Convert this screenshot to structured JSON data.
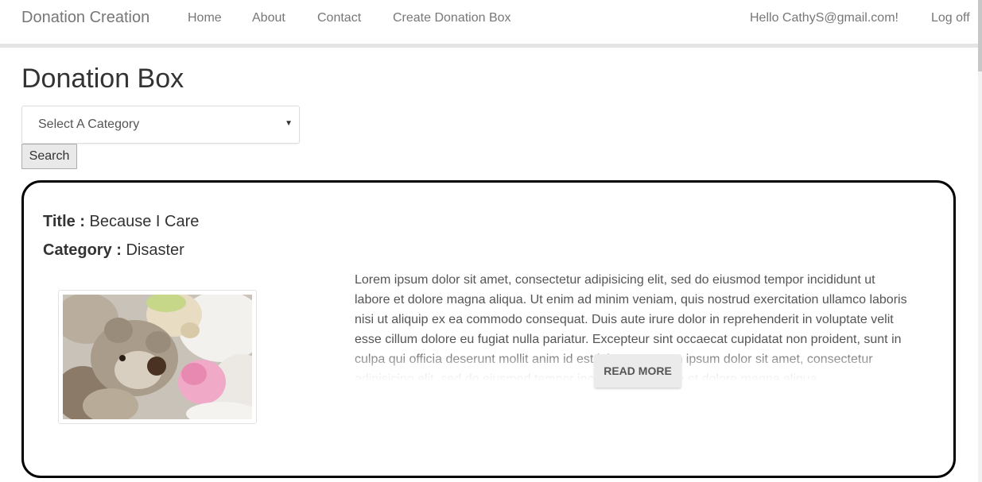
{
  "navbar": {
    "brand": "Donation Creation",
    "links": [
      "Home",
      "About",
      "Contact",
      "Create Donation Box"
    ],
    "greeting": "Hello CathyS@gmail.com!",
    "logoff": "Log off"
  },
  "page": {
    "title": "Donation Box"
  },
  "filter": {
    "category_selected": "Select A Category",
    "search_label": "Search"
  },
  "donation": {
    "title_label": "Title :",
    "title_value": "Because I Care",
    "category_label": "Category :",
    "category_value": "Disaster",
    "image_icon": "teddy-bears-photo",
    "description": "Lorem ipsum dolor sit amet, consectetur adipisicing elit, sed do eiusmod tempor incididunt ut labore et dolore magna aliqua. Ut enim ad minim veniam, quis nostrud exercitation ullamco laboris nisi ut aliquip ex ea commodo consequat. Duis aute irure dolor in reprehenderit in voluptate velit esse cillum dolore eu fugiat nulla pariatur. Excepteur sint occaecat cupidatat non proident, sunt in culpa qui officia deserunt mollit anim id est laborum.Lorem ipsum dolor sit amet, consectetur adipisicing elit, sed do eiusmod tempor incididunt ut labore et dolore magna aliqua.",
    "read_more_label": "READ MORE"
  },
  "colors": {
    "nav_text": "#777777",
    "card_border": "#000000",
    "button_bg": "#e9e9e9"
  }
}
